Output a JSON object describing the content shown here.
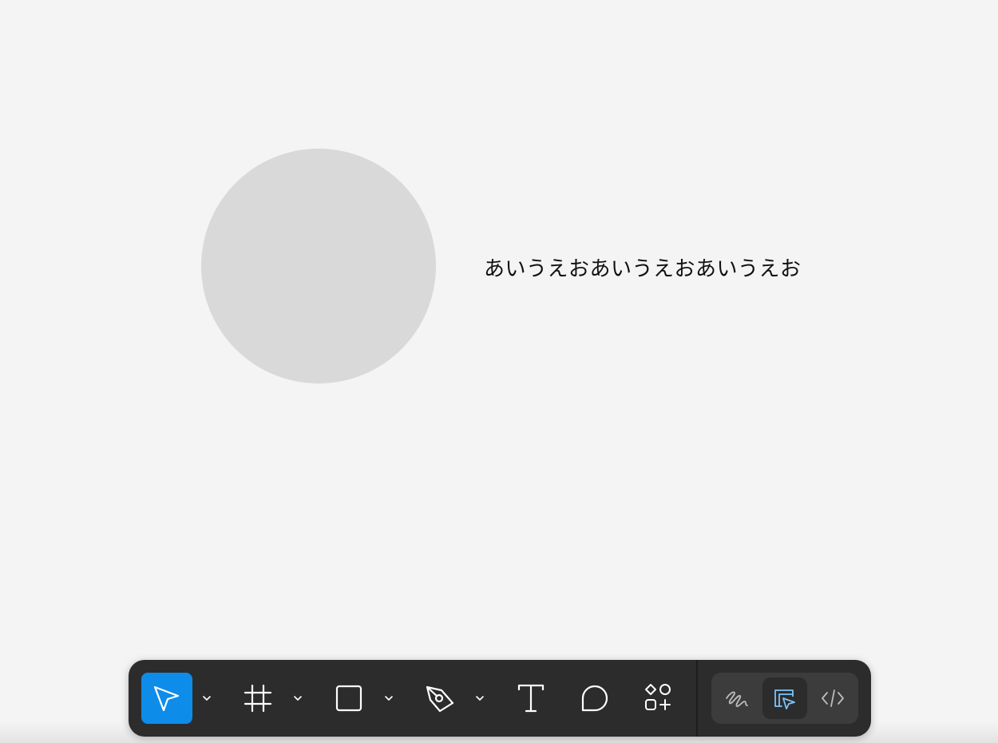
{
  "canvas": {
    "background": "#f4f4f4",
    "ellipse_fill": "#d9d9d9",
    "text_layer": "あいうえおあいうえおあいうえお"
  },
  "toolbar": {
    "background": "#2c2c2c",
    "accent": "#0d8ce9",
    "tools": [
      {
        "name": "move",
        "icon": "move-cursor-icon",
        "active": true,
        "has_menu": true
      },
      {
        "name": "frame",
        "icon": "frame-hash-icon",
        "active": false,
        "has_menu": true
      },
      {
        "name": "rectangle",
        "icon": "rectangle-icon",
        "active": false,
        "has_menu": true
      },
      {
        "name": "pen",
        "icon": "pen-nib-icon",
        "active": false,
        "has_menu": true
      },
      {
        "name": "text",
        "icon": "text-t-icon",
        "active": false,
        "has_menu": false
      },
      {
        "name": "comment",
        "icon": "comment-bubble-icon",
        "active": false,
        "has_menu": false
      },
      {
        "name": "actions",
        "icon": "shapes-plus-icon",
        "active": false,
        "has_menu": false
      }
    ],
    "modes": [
      {
        "name": "draw",
        "icon": "draw-squiggle-icon",
        "selected": false
      },
      {
        "name": "design",
        "icon": "design-ruler-cursor-icon",
        "selected": true,
        "color": "#7cc4fa"
      },
      {
        "name": "dev",
        "icon": "code-brackets-icon",
        "selected": false
      }
    ]
  }
}
